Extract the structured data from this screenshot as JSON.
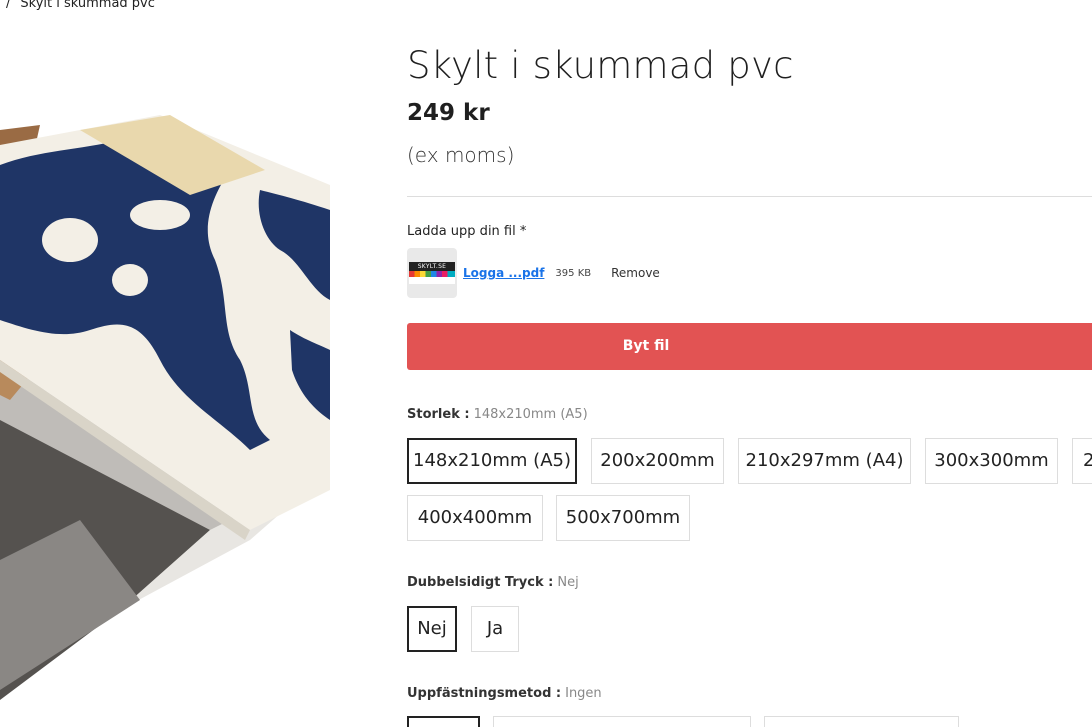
{
  "breadcrumb": {
    "separator": "/",
    "current": "Skylt i skummad pvc"
  },
  "product": {
    "title": "Skylt i skummad pvc",
    "price": "249 kr",
    "tax_note": "(ex moms)"
  },
  "upload": {
    "label": "Ladda upp din fil *",
    "thumb_text": "SKYLT.SE",
    "file_name": "Logga ...pdf",
    "file_size": "395 KB",
    "remove_label": "Remove",
    "replace_button": "Byt fil"
  },
  "size": {
    "label": "Storlek :",
    "selected": "148x210mm (A5)",
    "options": [
      "148x210mm (A5)",
      "200x200mm",
      "210x297mm (A4)",
      "300x300mm",
      "2",
      "400x400mm",
      "500x700mm"
    ]
  },
  "double_sided": {
    "label": "Dubbelsidigt Tryck :",
    "selected": "Nej",
    "options": [
      "Nej",
      "Ja"
    ]
  },
  "mounting": {
    "label": "Uppfästningsmetod :",
    "selected": "Ingen"
  },
  "colors": {
    "accent": "#e25353",
    "link": "#1a73e8",
    "navy": "#1f3566"
  }
}
